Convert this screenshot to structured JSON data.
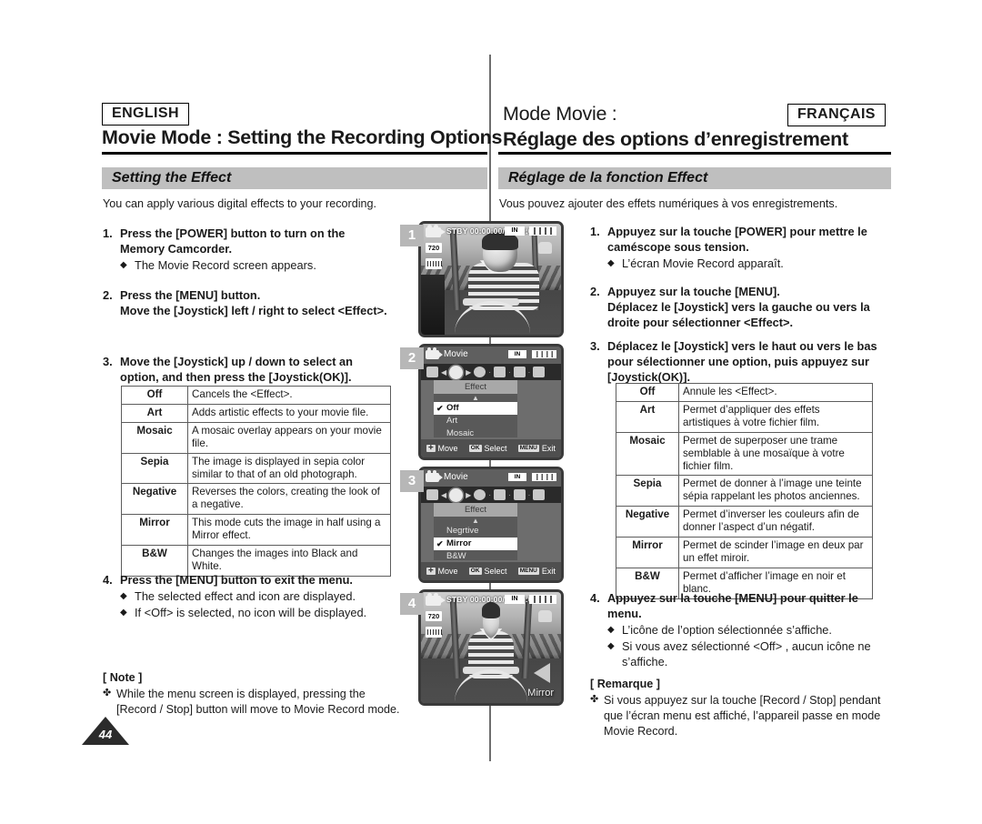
{
  "header": {
    "lang_en": "ENGLISH",
    "lang_fr": "FRANÇAIS",
    "title_en": "Movie Mode : Setting the Recording Options",
    "title_fr_line1": "Mode Movie :",
    "title_fr_line2": "Réglage des options d’enregistrement"
  },
  "section": {
    "title_en": "Setting the Effect",
    "title_fr": "Réglage de la fonction Effect",
    "intro_en": "You can apply various digital effects to your recording.",
    "intro_fr": "Vous pouvez ajouter des effets numériques à vos enregistrements."
  },
  "steps_en": [
    {
      "num": "1.",
      "lead": "Press the [POWER] button to turn on the Memory Camcorder.",
      "bullets": [
        "The Movie Record screen appears."
      ]
    },
    {
      "num": "2.",
      "lead": "Press the [MENU] button.\nMove the [Joystick] left / right to select <Effect>.",
      "bullets": []
    },
    {
      "num": "3.",
      "lead": "Move the [Joystick] up / down to select an option, and then press the [Joystick(OK)].",
      "bullets": []
    },
    {
      "num": "4.",
      "lead": "Press the [MENU] button to exit the menu.",
      "bullets": [
        "The selected effect and icon are displayed.",
        "If <Off> is selected, no icon will be displayed."
      ]
    }
  ],
  "steps_fr": [
    {
      "num": "1.",
      "lead": "Appuyez sur la touche [POWER] pour mettre le caméscope sous tension.",
      "bullets": [
        "L’écran Movie Record apparaît."
      ]
    },
    {
      "num": "2.",
      "lead": "Appuyez sur la touche [MENU].\nDéplacez le [Joystick] vers la gauche ou vers la droite pour sélectionner <Effect>.",
      "bullets": []
    },
    {
      "num": "3.",
      "lead": "Déplacez le [Joystick] vers le haut ou vers le bas pour sélectionner une option, puis appuyez sur [Joystick(OK)].",
      "bullets": []
    },
    {
      "num": "4.",
      "lead": "Appuyez sur la touche [MENU] pour quitter le menu.",
      "bullets": [
        "L’icône de l’option sélectionnée s’affiche.",
        "Si vous avez sélectionné <Off> , aucun icône ne s’affiche."
      ]
    }
  ],
  "table_en": [
    {
      "key": "Off",
      "desc": "Cancels the <Effect>."
    },
    {
      "key": "Art",
      "desc": "Adds artistic effects to your movie file."
    },
    {
      "key": "Mosaic",
      "desc": "A mosaic overlay appears on your movie file."
    },
    {
      "key": "Sepia",
      "desc": "The image is displayed in sepia color similar to that of an old photograph."
    },
    {
      "key": "Negative",
      "desc": "Reverses the colors, creating the look of a negative."
    },
    {
      "key": "Mirror",
      "desc": "This mode cuts the image in half using a Mirror effect."
    },
    {
      "key": "B&W",
      "desc": "Changes the images into Black and White."
    }
  ],
  "table_fr": [
    {
      "key": "Off",
      "desc": "Annule les <Effect>."
    },
    {
      "key": "Art",
      "desc": "Permet d’appliquer des effets artistiques à votre fichier film."
    },
    {
      "key": "Mosaic",
      "desc": "Permet de superposer une trame semblable à une mosaïque à votre fichier film."
    },
    {
      "key": "Sepia",
      "desc": "Permet de donner à l’image une teinte sépia rappelant les photos anciennes."
    },
    {
      "key": "Negative",
      "desc": "Permet d’inverser les couleurs afin de donner l’aspect d’un négatif."
    },
    {
      "key": "Mirror",
      "desc": "Permet de scinder l’image en deux par un effet miroir."
    },
    {
      "key": "B&W",
      "desc": "Permet d’afficher l’image en noir et blanc."
    }
  ],
  "note_en": {
    "title": "[ Note ]",
    "marker": "✤",
    "text": "While the menu screen is displayed, pressing the [Record / Stop] button will move to Movie Record mode."
  },
  "note_fr": {
    "title": "[ Remarque ]",
    "marker": "✤",
    "text": "Si vous appuyez sur la touche [Record / Stop] pendant que l’écran menu est affiché, l’appareil passe en mode Movie Record."
  },
  "page_number": "44",
  "screens": {
    "shot1": {
      "index": "1",
      "status": "STBY 00:00:00/00:40:05",
      "resolution": "720",
      "memory": "IN",
      "icons": [
        "camcorder-icon",
        "resolution-720-icon",
        "film-quality-icon",
        "memory-in-icon",
        "battery-icon",
        "hand-icon"
      ]
    },
    "shot2": {
      "index": "2",
      "title": "Movie",
      "tab": "Effect",
      "memory": "IN",
      "items": [
        {
          "label": "Off",
          "checked": true,
          "active": true
        },
        {
          "label": "Art",
          "checked": false,
          "active": false
        },
        {
          "label": "Mosaic",
          "checked": false,
          "active": false
        }
      ],
      "hints": [
        {
          "key": "✛",
          "label": "Move"
        },
        {
          "key": "OK",
          "label": "Select"
        },
        {
          "key": "MENU",
          "label": "Exit"
        }
      ]
    },
    "shot3": {
      "index": "3",
      "title": "Movie",
      "tab": "Effect",
      "memory": "IN",
      "items": [
        {
          "label": "Negrtive",
          "checked": false,
          "active": false
        },
        {
          "label": "Mirror",
          "checked": true,
          "active": true
        },
        {
          "label": "B&W",
          "checked": false,
          "active": false
        }
      ],
      "hints": [
        {
          "key": "✛",
          "label": "Move"
        },
        {
          "key": "OK",
          "label": "Select"
        },
        {
          "key": "MENU",
          "label": "Exit"
        }
      ]
    },
    "shot4": {
      "index": "4",
      "status": "STBY 00:00:00/00:40:05",
      "resolution": "720",
      "memory": "IN",
      "effect_label": "Mirror"
    }
  },
  "colors": {
    "section_bar": "#bfbfbf",
    "rule": "#000000",
    "page_badge": "#2b2b2b",
    "divider": "#6e6e6e"
  }
}
